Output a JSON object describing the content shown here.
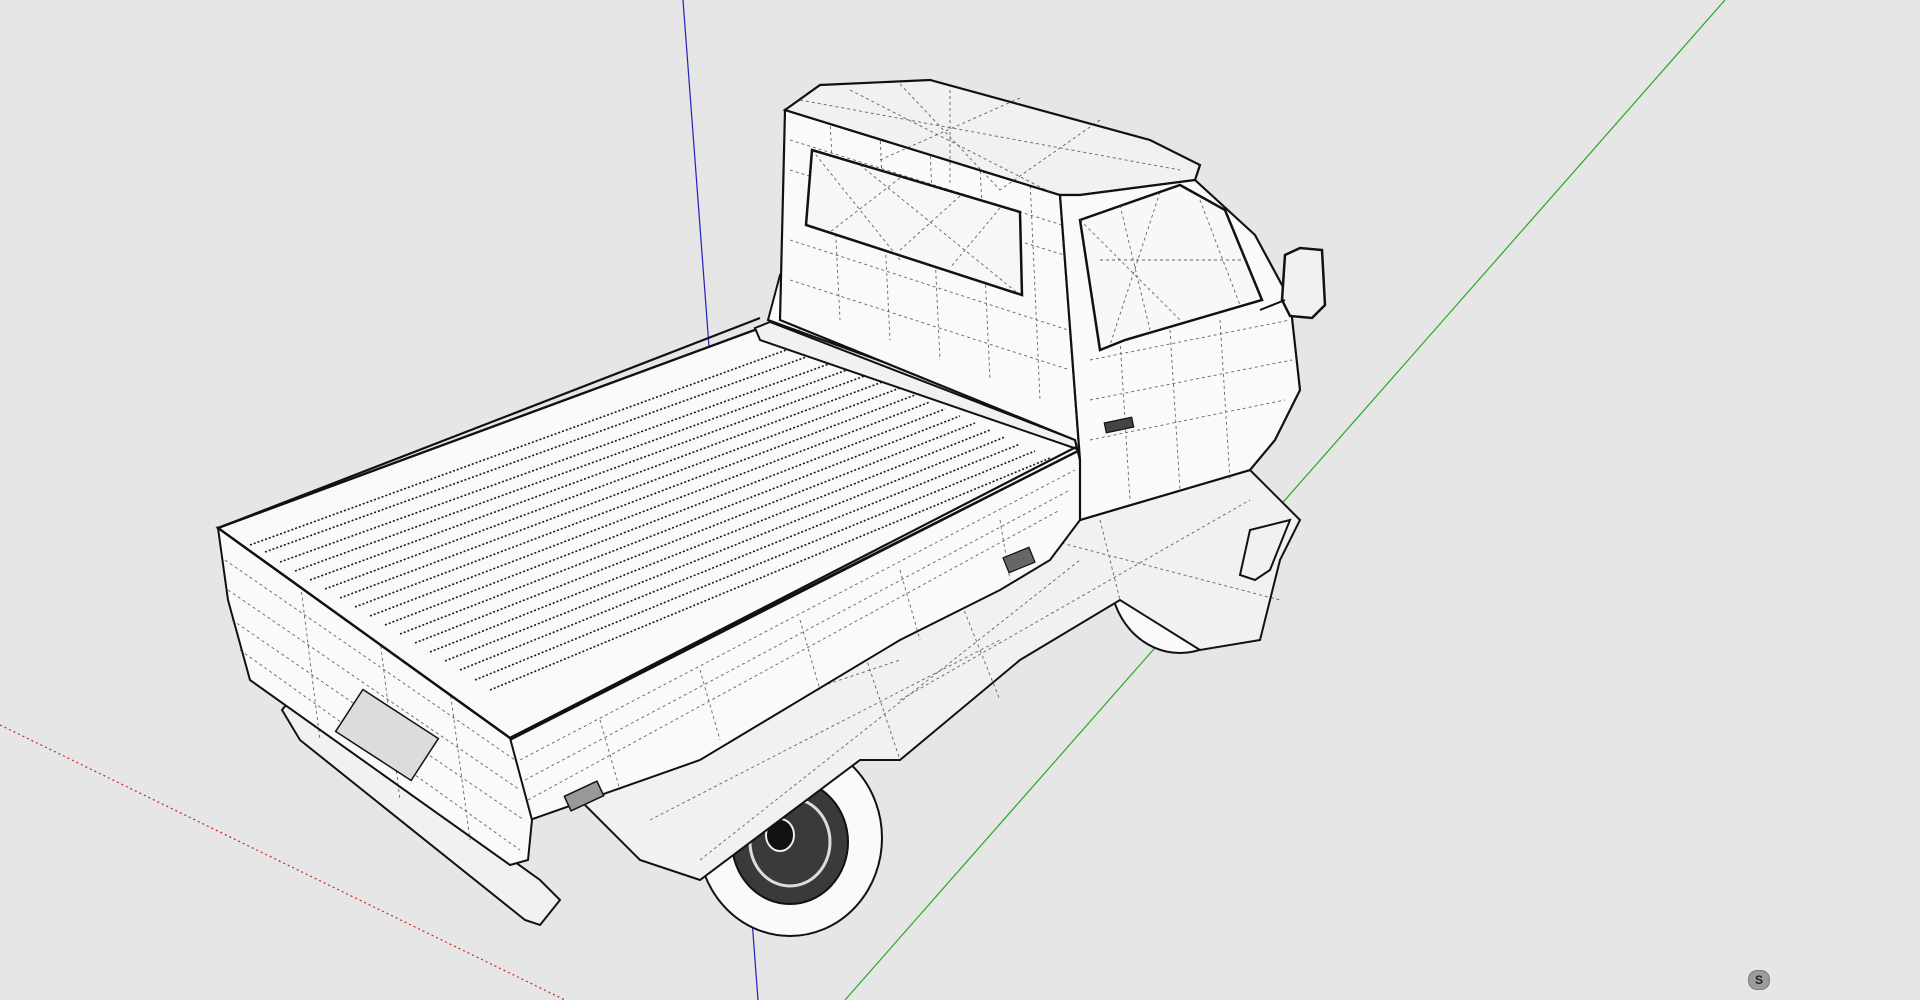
{
  "viewport": {
    "background_color": "#e6e6e6",
    "axes": {
      "red_axis_color": "#cc2222",
      "green_axis_color": "#22aa22",
      "blue_axis_color": "#2222bb"
    },
    "model": {
      "name_icon": "kei-truck-wireframe",
      "style": "hidden-line with dashed mesh edges"
    }
  },
  "corner_widget": {
    "label": "S",
    "icon": "sketchup-logo-icon"
  }
}
